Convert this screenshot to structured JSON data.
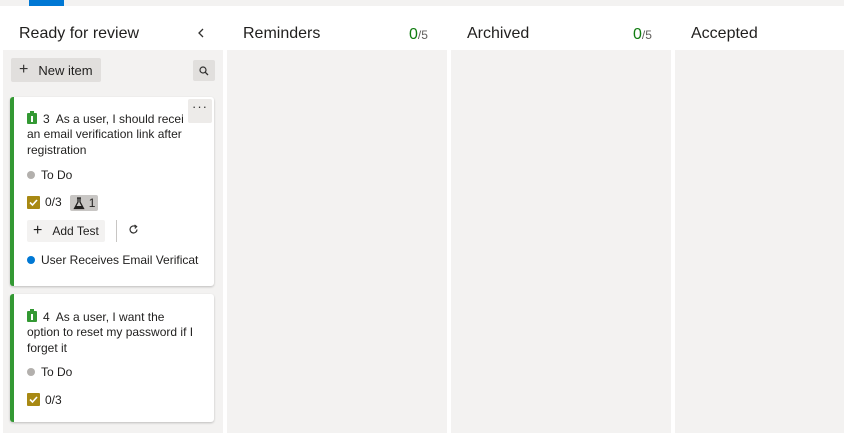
{
  "columns": [
    {
      "title": "Ready for review",
      "collapse_icon": "chevron-left"
    },
    {
      "title": "Reminders",
      "count": "0",
      "limit": "/5"
    },
    {
      "title": "Archived",
      "count": "0",
      "limit": "/5"
    },
    {
      "title": "Accepted"
    }
  ],
  "toolbar": {
    "new_item_label": "New item",
    "plus_glyph": "+",
    "search_icon": "search"
  },
  "cards": [
    {
      "type_icon": "user-story-icon",
      "id": "3",
      "title_line1": "As a user, I should recei",
      "title_line2": "an email verification link after",
      "title_line3": "registration",
      "state": "To Do",
      "state_color": "#b3b0ad",
      "tasks": "0/3",
      "tests": "1",
      "add_test_label": "Add Test",
      "parent": "User Receives Email Verificat",
      "parent_color": "#0078d4",
      "more": "···"
    },
    {
      "type_icon": "user-story-icon",
      "id": "4",
      "title_line1": "As a user, I want the",
      "title_line2": "option to reset my password if I",
      "title_line3": "forget it",
      "state": "To Do",
      "state_color": "#b3b0ad",
      "tasks": "0/3"
    }
  ],
  "colors": {
    "accent": "#0078d4",
    "story": "#339933",
    "count": "#107c10",
    "checklist": "#a88913"
  }
}
